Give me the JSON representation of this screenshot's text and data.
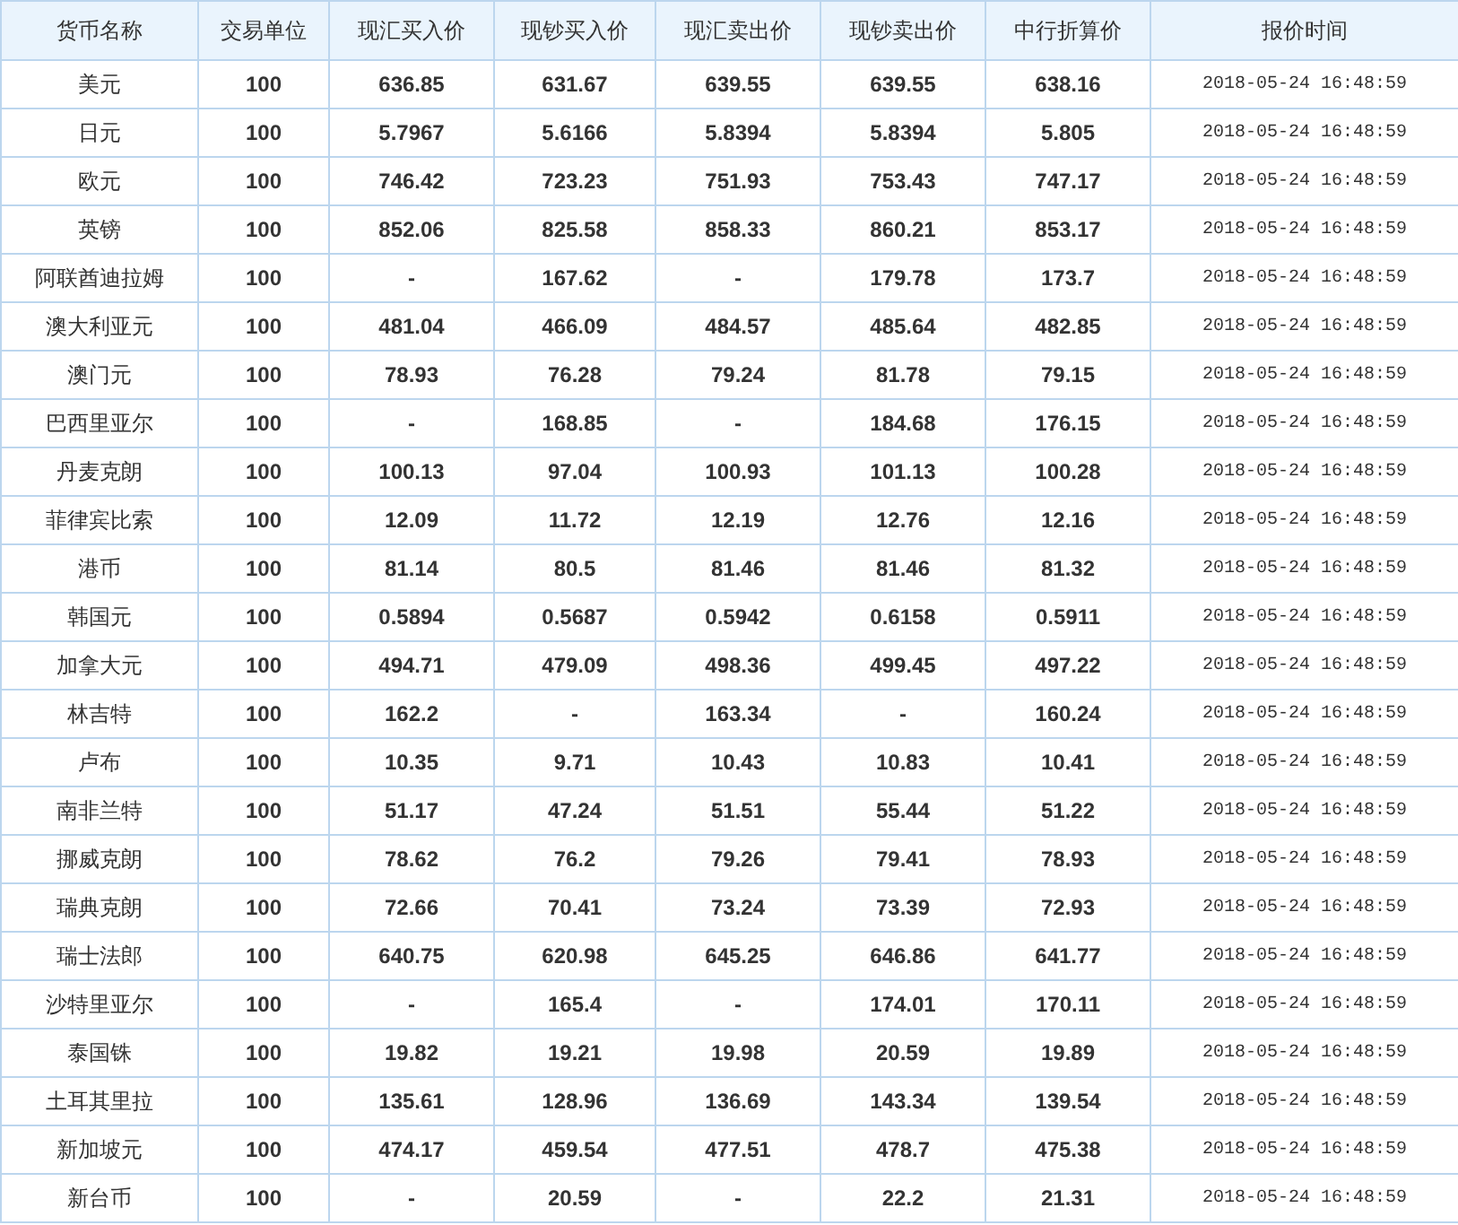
{
  "table": {
    "columns": [
      "货币名称",
      "交易单位",
      "现汇买入价",
      "现钞买入价",
      "现汇卖出价",
      "现钞卖出价",
      "中行折算价",
      "报价时间"
    ],
    "rows": [
      [
        "美元",
        "100",
        "636.85",
        "631.67",
        "639.55",
        "639.55",
        "638.16",
        "2018-05-24 16:48:59"
      ],
      [
        "日元",
        "100",
        "5.7967",
        "5.6166",
        "5.8394",
        "5.8394",
        "5.805",
        "2018-05-24 16:48:59"
      ],
      [
        "欧元",
        "100",
        "746.42",
        "723.23",
        "751.93",
        "753.43",
        "747.17",
        "2018-05-24 16:48:59"
      ],
      [
        "英镑",
        "100",
        "852.06",
        "825.58",
        "858.33",
        "860.21",
        "853.17",
        "2018-05-24 16:48:59"
      ],
      [
        "阿联酋迪拉姆",
        "100",
        "-",
        "167.62",
        "-",
        "179.78",
        "173.7",
        "2018-05-24 16:48:59"
      ],
      [
        "澳大利亚元",
        "100",
        "481.04",
        "466.09",
        "484.57",
        "485.64",
        "482.85",
        "2018-05-24 16:48:59"
      ],
      [
        "澳门元",
        "100",
        "78.93",
        "76.28",
        "79.24",
        "81.78",
        "79.15",
        "2018-05-24 16:48:59"
      ],
      [
        "巴西里亚尔",
        "100",
        "-",
        "168.85",
        "-",
        "184.68",
        "176.15",
        "2018-05-24 16:48:59"
      ],
      [
        "丹麦克朗",
        "100",
        "100.13",
        "97.04",
        "100.93",
        "101.13",
        "100.28",
        "2018-05-24 16:48:59"
      ],
      [
        "菲律宾比索",
        "100",
        "12.09",
        "11.72",
        "12.19",
        "12.76",
        "12.16",
        "2018-05-24 16:48:59"
      ],
      [
        "港币",
        "100",
        "81.14",
        "80.5",
        "81.46",
        "81.46",
        "81.32",
        "2018-05-24 16:48:59"
      ],
      [
        "韩国元",
        "100",
        "0.5894",
        "0.5687",
        "0.5942",
        "0.6158",
        "0.5911",
        "2018-05-24 16:48:59"
      ],
      [
        "加拿大元",
        "100",
        "494.71",
        "479.09",
        "498.36",
        "499.45",
        "497.22",
        "2018-05-24 16:48:59"
      ],
      [
        "林吉特",
        "100",
        "162.2",
        "-",
        "163.34",
        "-",
        "160.24",
        "2018-05-24 16:48:59"
      ],
      [
        "卢布",
        "100",
        "10.35",
        "9.71",
        "10.43",
        "10.83",
        "10.41",
        "2018-05-24 16:48:59"
      ],
      [
        "南非兰特",
        "100",
        "51.17",
        "47.24",
        "51.51",
        "55.44",
        "51.22",
        "2018-05-24 16:48:59"
      ],
      [
        "挪威克朗",
        "100",
        "78.62",
        "76.2",
        "79.26",
        "79.41",
        "78.93",
        "2018-05-24 16:48:59"
      ],
      [
        "瑞典克朗",
        "100",
        "72.66",
        "70.41",
        "73.24",
        "73.39",
        "72.93",
        "2018-05-24 16:48:59"
      ],
      [
        "瑞士法郎",
        "100",
        "640.75",
        "620.98",
        "645.25",
        "646.86",
        "641.77",
        "2018-05-24 16:48:59"
      ],
      [
        "沙特里亚尔",
        "100",
        "-",
        "165.4",
        "-",
        "174.01",
        "170.11",
        "2018-05-24 16:48:59"
      ],
      [
        "泰国铢",
        "100",
        "19.82",
        "19.21",
        "19.98",
        "20.59",
        "19.89",
        "2018-05-24 16:48:59"
      ],
      [
        "土耳其里拉",
        "100",
        "135.61",
        "128.96",
        "136.69",
        "143.34",
        "139.54",
        "2018-05-24 16:48:59"
      ],
      [
        "新加坡元",
        "100",
        "474.17",
        "459.54",
        "477.51",
        "478.7",
        "475.38",
        "2018-05-24 16:48:59"
      ],
      [
        "新台币",
        "100",
        "-",
        "20.59",
        "-",
        "22.2",
        "21.31",
        "2018-05-24 16:48:59"
      ]
    ]
  }
}
